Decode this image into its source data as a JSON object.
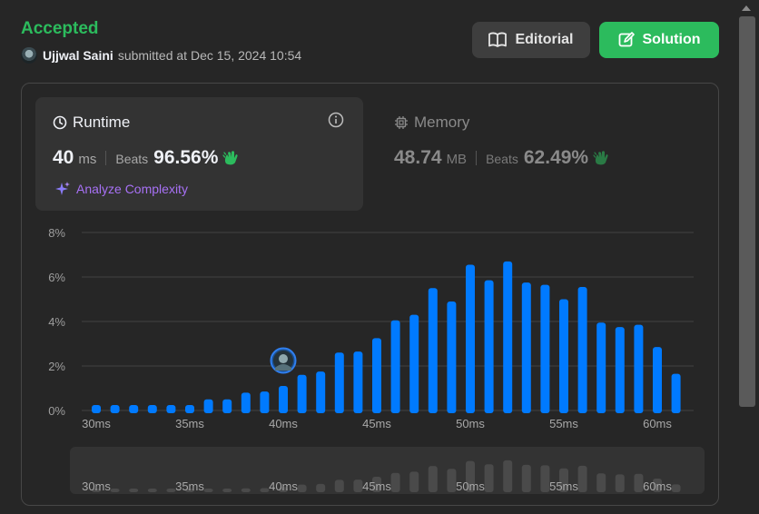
{
  "header": {
    "status": "Accepted",
    "username": "Ujjwal Saini",
    "submitted_text": "submitted at Dec 15, 2024 10:54"
  },
  "buttons": {
    "editorial": "Editorial",
    "solution": "Solution"
  },
  "runtime": {
    "title": "Runtime",
    "value": "40",
    "unit": "ms",
    "beats_label": "Beats",
    "beats_pct": "96.56%",
    "analyze_label": "Analyze Complexity"
  },
  "memory": {
    "title": "Memory",
    "value": "48.74",
    "unit": "MB",
    "beats_label": "Beats",
    "beats_pct": "62.49%"
  },
  "colors": {
    "accent_green": "#2cbb5d",
    "bar_blue": "#007aff",
    "analyze_purple": "#a771f5"
  },
  "icons": {
    "editorial": "book-icon",
    "solution": "edit-icon",
    "runtime": "clock-icon",
    "info": "info-icon",
    "memory": "chip-icon",
    "beats": "clap-icon",
    "analyze": "sparkle-icon"
  },
  "chart_data": {
    "type": "bar",
    "x": [
      30,
      31,
      32,
      33,
      34,
      35,
      36,
      37,
      38,
      39,
      40,
      41,
      42,
      43,
      44,
      45,
      46,
      47,
      48,
      49,
      50,
      51,
      52,
      53,
      54,
      55,
      56,
      57,
      58,
      59,
      60,
      61
    ],
    "values": [
      0.2,
      0.2,
      0.2,
      0.2,
      0.2,
      0.2,
      0.5,
      0.5,
      0.8,
      0.85,
      1.1,
      1.6,
      1.75,
      2.6,
      2.65,
      3.25,
      4.05,
      4.3,
      5.5,
      4.9,
      6.55,
      5.85,
      6.7,
      5.75,
      5.65,
      5.0,
      5.55,
      3.95,
      3.75,
      3.85,
      2.85,
      1.65
    ],
    "x_tick_labels": [
      "30ms",
      "35ms",
      "40ms",
      "45ms",
      "50ms",
      "55ms",
      "60ms"
    ],
    "x_tick_values": [
      30,
      35,
      40,
      45,
      50,
      55,
      60
    ],
    "y_tick_labels": [
      "0%",
      "2%",
      "4%",
      "6%",
      "8%"
    ],
    "y_tick_values": [
      0,
      2,
      4,
      6,
      8
    ],
    "ylim": [
      0,
      8
    ],
    "grid": true,
    "user_marker_x": 40
  }
}
